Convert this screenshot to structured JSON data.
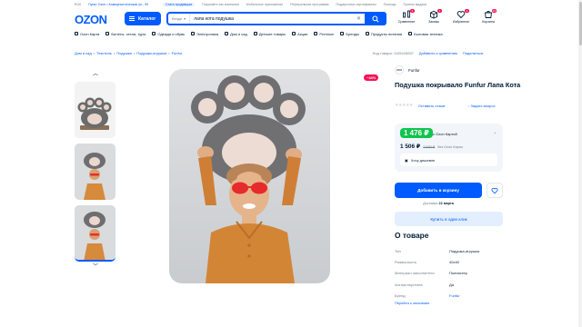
{
  "topbar": {
    "badge": "RUS",
    "location": "Пункт Ozon • Коммунистическая ул., 99",
    "seller_link": "Стать продавцом",
    "links": [
      "Покупайте как компания",
      "Мобильное приложение",
      "Реферальная программа",
      "Подарочные сертификаты",
      "Помощь",
      "Пункты выдачи"
    ]
  },
  "header": {
    "logo": "OZON",
    "catalog_label": "Каталог",
    "search_category": "Везде",
    "search_value": "лапа кота подушка",
    "icons": [
      {
        "label": "Сравнение",
        "count": "5",
        "icon": "compare-icon"
      },
      {
        "label": "Заказы",
        "count": "1",
        "icon": "box-icon"
      },
      {
        "label": "Избранное",
        "count": "4",
        "icon": "heart-icon"
      },
      {
        "label": "Корзина",
        "count": "23",
        "icon": "cart-icon"
      }
    ]
  },
  "catnav": [
    "Ozon Карта",
    "Билеты, отели, туры",
    "Одежда и обувь",
    "Электроника",
    "Дом и сад",
    "Детские товары",
    "Акции",
    "Premium",
    "Бренды",
    "Продукты питания",
    "Бытовая техника"
  ],
  "breadcrumbs": [
    "Дом и сад",
    "Текстиль",
    "Подушки",
    "Подушки-игрушки",
    "Funfur"
  ],
  "article": {
    "code": "Код товара: 1105428287",
    "compare": "Добавить к сравнению",
    "share": "Поделиться"
  },
  "product": {
    "discount": "−44%",
    "brand": "Funfur",
    "title": "Подушка покрывало Funfur Лапа Кота",
    "stars": "★★★★★",
    "review_link": "Оставить отзыв",
    "question_link": "Задать вопрос",
    "price_card": "1 476 ₽",
    "price_card_note": "с Ozon Картой",
    "price_regular": "1 506 ₽",
    "price_old": "2 690 ₽",
    "price_regular_note": "без Ozon Карты",
    "cheaper_label": "Хочу дешевле",
    "cart_label": "Добавить в корзину",
    "delivery_text": "Доставка",
    "delivery_date": "22 марта",
    "oneclick_label": "Купить в один клик"
  },
  "about": {
    "title": "О товаре",
    "specs": [
      {
        "k": "Тип",
        "v": "Подушка-игрушка"
      },
      {
        "k": "Размерность",
        "v": "40х40"
      },
      {
        "k": "Материал наполнителя",
        "v": "Полиэстер"
      },
      {
        "k": "Антиаллергенна",
        "v": "Да"
      },
      {
        "k": "Бренд",
        "v": "Funfur"
      }
    ],
    "all_link": "Перейти к описанию"
  },
  "colors": {
    "accent": "#005bff",
    "sale": "#f91155",
    "green": "#10c44c"
  }
}
